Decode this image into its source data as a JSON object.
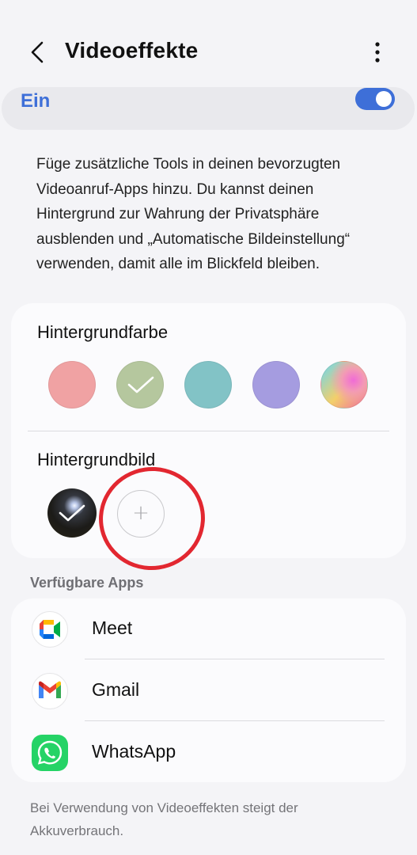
{
  "header": {
    "title": "Videoeffekte",
    "back_icon": "chevron-left-icon",
    "more_icon": "more-vertical-icon"
  },
  "master_switch": {
    "label": "Ein",
    "state": "on",
    "accent": "#3e6fd8"
  },
  "description": "Füge zusätzliche Tools in deinen bevorzugten Videoanruf-Apps hinzu. Du kannst deinen Hintergrund zur Wahrung der Privatsphäre ausblenden und „Automatische Bildeinstellung“ verwenden, damit alle im Blickfeld bleiben.",
  "background_color": {
    "label": "Hintergrundfarbe",
    "swatches": [
      {
        "name": "pink",
        "color": "#f0a2a3",
        "selected": false
      },
      {
        "name": "green",
        "color": "#b5c79e",
        "selected": true
      },
      {
        "name": "teal",
        "color": "#82c3c6",
        "selected": false
      },
      {
        "name": "purple",
        "color": "#a59ce0",
        "selected": false
      },
      {
        "name": "gradient",
        "color": "gradient",
        "selected": false
      }
    ]
  },
  "background_image": {
    "label": "Hintergrundbild",
    "thumbnail_selected": true,
    "add_symbol": "+"
  },
  "apps": {
    "header": "Verfügbare Apps",
    "items": [
      {
        "name": "Meet",
        "icon": "google-meet-icon"
      },
      {
        "name": "Gmail",
        "icon": "gmail-icon"
      },
      {
        "name": "WhatsApp",
        "icon": "whatsapp-icon"
      }
    ]
  },
  "footer_note": "Bei Verwendung von Videoeffekten steigt der Akkuverbrauch.",
  "annotation": {
    "color": "#e22730"
  }
}
